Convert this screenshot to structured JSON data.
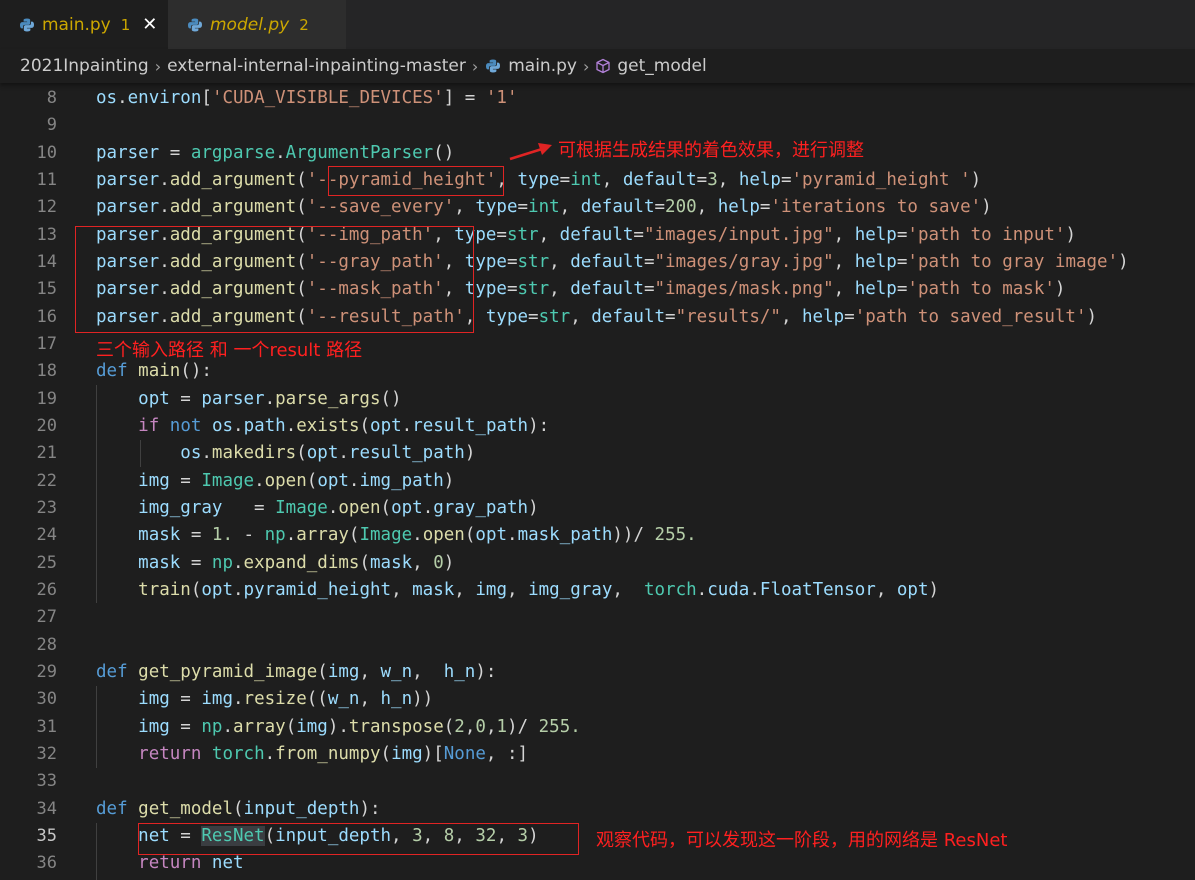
{
  "tabs": [
    {
      "label": "main.py",
      "count": "1",
      "close": "✕"
    },
    {
      "label": "model.py",
      "count": "2"
    }
  ],
  "breadcrumb": [
    "2021Inpainting",
    "external-internal-inpainting-master",
    "main.py",
    "get_model"
  ],
  "current_line": 35,
  "annotations": {
    "pyramid_note": "可根据生成结果的着色效果，进行调整",
    "paths_note": "三个输入路径 和 一个result 路径",
    "resnet_note": "观察代码，可以发现这一阶段，用的网络是 ResNet"
  },
  "colors": {
    "annotation": "#ff2020",
    "keyword": "#569cd6",
    "control": "#c586c0",
    "string": "#ce9178",
    "number": "#b5cea8",
    "variable": "#9cdcfe",
    "function": "#dcdcaa",
    "class": "#4ec9b0"
  },
  "code_lines": [
    {
      "num": 8,
      "tokens": [
        [
          "v",
          "os"
        ],
        [
          "p",
          "."
        ],
        [
          "v",
          "environ"
        ],
        [
          "p",
          "["
        ],
        [
          "s",
          "'CUDA_VISIBLE_DEVICES'"
        ],
        [
          "p",
          "] = "
        ],
        [
          "s",
          "'1'"
        ]
      ]
    },
    {
      "num": 9,
      "tokens": []
    },
    {
      "num": 10,
      "tokens": [
        [
          "v",
          "parser"
        ],
        [
          "p",
          " = "
        ],
        [
          "t",
          "argparse"
        ],
        [
          "p",
          "."
        ],
        [
          "t",
          "ArgumentParser"
        ],
        [
          "p",
          "()"
        ]
      ]
    },
    {
      "num": 11,
      "tokens": [
        [
          "v",
          "parser"
        ],
        [
          "p",
          "."
        ],
        [
          "f",
          "add_argument"
        ],
        [
          "p",
          "("
        ],
        [
          "s",
          "'--pyramid_height'"
        ],
        [
          "p",
          ", "
        ],
        [
          "v",
          "type"
        ],
        [
          "p",
          "="
        ],
        [
          "t",
          "int"
        ],
        [
          "p",
          ", "
        ],
        [
          "v",
          "default"
        ],
        [
          "p",
          "="
        ],
        [
          "n",
          "3"
        ],
        [
          "p",
          ", "
        ],
        [
          "v",
          "help"
        ],
        [
          "p",
          "="
        ],
        [
          "s",
          "'pyramid_height '"
        ],
        [
          "p",
          ")"
        ]
      ]
    },
    {
      "num": 12,
      "tokens": [
        [
          "v",
          "parser"
        ],
        [
          "p",
          "."
        ],
        [
          "f",
          "add_argument"
        ],
        [
          "p",
          "("
        ],
        [
          "s",
          "'--save_every'"
        ],
        [
          "p",
          ", "
        ],
        [
          "v",
          "type"
        ],
        [
          "p",
          "="
        ],
        [
          "t",
          "int"
        ],
        [
          "p",
          ", "
        ],
        [
          "v",
          "default"
        ],
        [
          "p",
          "="
        ],
        [
          "n",
          "200"
        ],
        [
          "p",
          ", "
        ],
        [
          "v",
          "help"
        ],
        [
          "p",
          "="
        ],
        [
          "s",
          "'iterations to save'"
        ],
        [
          "p",
          ")"
        ]
      ]
    },
    {
      "num": 13,
      "tokens": [
        [
          "v",
          "parser"
        ],
        [
          "p",
          "."
        ],
        [
          "f",
          "add_argument"
        ],
        [
          "p",
          "("
        ],
        [
          "s",
          "'--img_path'"
        ],
        [
          "p",
          ", "
        ],
        [
          "v",
          "type"
        ],
        [
          "p",
          "="
        ],
        [
          "t",
          "str"
        ],
        [
          "p",
          ", "
        ],
        [
          "v",
          "default"
        ],
        [
          "p",
          "="
        ],
        [
          "s",
          "\"images/input.jpg\""
        ],
        [
          "p",
          ", "
        ],
        [
          "v",
          "help"
        ],
        [
          "p",
          "="
        ],
        [
          "s",
          "'path to input'"
        ],
        [
          "p",
          ")"
        ]
      ]
    },
    {
      "num": 14,
      "tokens": [
        [
          "v",
          "parser"
        ],
        [
          "p",
          "."
        ],
        [
          "f",
          "add_argument"
        ],
        [
          "p",
          "("
        ],
        [
          "s",
          "'--gray_path'"
        ],
        [
          "p",
          ", "
        ],
        [
          "v",
          "type"
        ],
        [
          "p",
          "="
        ],
        [
          "t",
          "str"
        ],
        [
          "p",
          ", "
        ],
        [
          "v",
          "default"
        ],
        [
          "p",
          "="
        ],
        [
          "s",
          "\"images/gray.jpg\""
        ],
        [
          "p",
          ", "
        ],
        [
          "v",
          "help"
        ],
        [
          "p",
          "="
        ],
        [
          "s",
          "'path to gray image'"
        ],
        [
          "p",
          ")"
        ]
      ]
    },
    {
      "num": 15,
      "tokens": [
        [
          "v",
          "parser"
        ],
        [
          "p",
          "."
        ],
        [
          "f",
          "add_argument"
        ],
        [
          "p",
          "("
        ],
        [
          "s",
          "'--mask_path'"
        ],
        [
          "p",
          ", "
        ],
        [
          "v",
          "type"
        ],
        [
          "p",
          "="
        ],
        [
          "t",
          "str"
        ],
        [
          "p",
          ", "
        ],
        [
          "v",
          "default"
        ],
        [
          "p",
          "="
        ],
        [
          "s",
          "\"images/mask.png\""
        ],
        [
          "p",
          ", "
        ],
        [
          "v",
          "help"
        ],
        [
          "p",
          "="
        ],
        [
          "s",
          "'path to mask'"
        ],
        [
          "p",
          ")"
        ]
      ]
    },
    {
      "num": 16,
      "tokens": [
        [
          "v",
          "parser"
        ],
        [
          "p",
          "."
        ],
        [
          "f",
          "add_argument"
        ],
        [
          "p",
          "("
        ],
        [
          "s",
          "'--result_path'"
        ],
        [
          "p",
          ", "
        ],
        [
          "v",
          "type"
        ],
        [
          "p",
          "="
        ],
        [
          "t",
          "str"
        ],
        [
          "p",
          ", "
        ],
        [
          "v",
          "default"
        ],
        [
          "p",
          "="
        ],
        [
          "s",
          "\"results/\""
        ],
        [
          "p",
          ", "
        ],
        [
          "v",
          "help"
        ],
        [
          "p",
          "="
        ],
        [
          "s",
          "'path to saved_result'"
        ],
        [
          "p",
          ")"
        ]
      ]
    },
    {
      "num": 17,
      "tokens": []
    },
    {
      "num": 18,
      "tokens": [
        [
          "k",
          "def"
        ],
        [
          "p",
          " "
        ],
        [
          "f",
          "main"
        ],
        [
          "p",
          "():"
        ]
      ]
    },
    {
      "num": 19,
      "tokens": [
        [
          "p",
          "    "
        ],
        [
          "v",
          "opt"
        ],
        [
          "p",
          " = "
        ],
        [
          "v",
          "parser"
        ],
        [
          "p",
          "."
        ],
        [
          "f",
          "parse_args"
        ],
        [
          "p",
          "()"
        ]
      ]
    },
    {
      "num": 20,
      "tokens": [
        [
          "p",
          "    "
        ],
        [
          "c",
          "if"
        ],
        [
          "p",
          " "
        ],
        [
          "k",
          "not"
        ],
        [
          "p",
          " "
        ],
        [
          "v",
          "os"
        ],
        [
          "p",
          "."
        ],
        [
          "v",
          "path"
        ],
        [
          "p",
          "."
        ],
        [
          "f",
          "exists"
        ],
        [
          "p",
          "("
        ],
        [
          "v",
          "opt"
        ],
        [
          "p",
          "."
        ],
        [
          "v",
          "result_path"
        ],
        [
          "p",
          "):"
        ]
      ]
    },
    {
      "num": 21,
      "tokens": [
        [
          "p",
          "        "
        ],
        [
          "v",
          "os"
        ],
        [
          "p",
          "."
        ],
        [
          "f",
          "makedirs"
        ],
        [
          "p",
          "("
        ],
        [
          "v",
          "opt"
        ],
        [
          "p",
          "."
        ],
        [
          "v",
          "result_path"
        ],
        [
          "p",
          ")"
        ]
      ]
    },
    {
      "num": 22,
      "tokens": [
        [
          "p",
          "    "
        ],
        [
          "v",
          "img"
        ],
        [
          "p",
          " = "
        ],
        [
          "t",
          "Image"
        ],
        [
          "p",
          "."
        ],
        [
          "f",
          "open"
        ],
        [
          "p",
          "("
        ],
        [
          "v",
          "opt"
        ],
        [
          "p",
          "."
        ],
        [
          "v",
          "img_path"
        ],
        [
          "p",
          ")"
        ]
      ]
    },
    {
      "num": 23,
      "tokens": [
        [
          "p",
          "    "
        ],
        [
          "v",
          "img_gray"
        ],
        [
          "p",
          "   = "
        ],
        [
          "t",
          "Image"
        ],
        [
          "p",
          "."
        ],
        [
          "f",
          "open"
        ],
        [
          "p",
          "("
        ],
        [
          "v",
          "opt"
        ],
        [
          "p",
          "."
        ],
        [
          "v",
          "gray_path"
        ],
        [
          "p",
          ")"
        ]
      ]
    },
    {
      "num": 24,
      "tokens": [
        [
          "p",
          "    "
        ],
        [
          "v",
          "mask"
        ],
        [
          "p",
          " = "
        ],
        [
          "n",
          "1."
        ],
        [
          "p",
          " - "
        ],
        [
          "t",
          "np"
        ],
        [
          "p",
          "."
        ],
        [
          "f",
          "array"
        ],
        [
          "p",
          "("
        ],
        [
          "t",
          "Image"
        ],
        [
          "p",
          "."
        ],
        [
          "f",
          "open"
        ],
        [
          "p",
          "("
        ],
        [
          "v",
          "opt"
        ],
        [
          "p",
          "."
        ],
        [
          "v",
          "mask_path"
        ],
        [
          "p",
          "))/ "
        ],
        [
          "n",
          "255."
        ]
      ]
    },
    {
      "num": 25,
      "tokens": [
        [
          "p",
          "    "
        ],
        [
          "v",
          "mask"
        ],
        [
          "p",
          " = "
        ],
        [
          "t",
          "np"
        ],
        [
          "p",
          "."
        ],
        [
          "f",
          "expand_dims"
        ],
        [
          "p",
          "("
        ],
        [
          "v",
          "mask"
        ],
        [
          "p",
          ", "
        ],
        [
          "n",
          "0"
        ],
        [
          "p",
          ")"
        ]
      ]
    },
    {
      "num": 26,
      "tokens": [
        [
          "p",
          "    "
        ],
        [
          "f",
          "train"
        ],
        [
          "p",
          "("
        ],
        [
          "v",
          "opt"
        ],
        [
          "p",
          "."
        ],
        [
          "v",
          "pyramid_height"
        ],
        [
          "p",
          ", "
        ],
        [
          "v",
          "mask"
        ],
        [
          "p",
          ", "
        ],
        [
          "v",
          "img"
        ],
        [
          "p",
          ", "
        ],
        [
          "v",
          "img_gray"
        ],
        [
          "p",
          ",  "
        ],
        [
          "t",
          "torch"
        ],
        [
          "p",
          "."
        ],
        [
          "v",
          "cuda"
        ],
        [
          "p",
          "."
        ],
        [
          "v",
          "FloatTensor"
        ],
        [
          "p",
          ", "
        ],
        [
          "v",
          "opt"
        ],
        [
          "p",
          ")"
        ]
      ]
    },
    {
      "num": 27,
      "tokens": []
    },
    {
      "num": 28,
      "tokens": []
    },
    {
      "num": 29,
      "tokens": [
        [
          "k",
          "def"
        ],
        [
          "p",
          " "
        ],
        [
          "f",
          "get_pyramid_image"
        ],
        [
          "p",
          "("
        ],
        [
          "v",
          "img"
        ],
        [
          "p",
          ", "
        ],
        [
          "v",
          "w_n"
        ],
        [
          "p",
          ",  "
        ],
        [
          "v",
          "h_n"
        ],
        [
          "p",
          "):"
        ]
      ]
    },
    {
      "num": 30,
      "tokens": [
        [
          "p",
          "    "
        ],
        [
          "v",
          "img"
        ],
        [
          "p",
          " = "
        ],
        [
          "v",
          "img"
        ],
        [
          "p",
          "."
        ],
        [
          "f",
          "resize"
        ],
        [
          "p",
          "(("
        ],
        [
          "v",
          "w_n"
        ],
        [
          "p",
          ", "
        ],
        [
          "v",
          "h_n"
        ],
        [
          "p",
          "))"
        ]
      ]
    },
    {
      "num": 31,
      "tokens": [
        [
          "p",
          "    "
        ],
        [
          "v",
          "img"
        ],
        [
          "p",
          " = "
        ],
        [
          "t",
          "np"
        ],
        [
          "p",
          "."
        ],
        [
          "f",
          "array"
        ],
        [
          "p",
          "("
        ],
        [
          "v",
          "img"
        ],
        [
          "p",
          ")."
        ],
        [
          "f",
          "transpose"
        ],
        [
          "p",
          "("
        ],
        [
          "n",
          "2"
        ],
        [
          "p",
          ","
        ],
        [
          "n",
          "0"
        ],
        [
          "p",
          ","
        ],
        [
          "n",
          "1"
        ],
        [
          "p",
          ")/ "
        ],
        [
          "n",
          "255."
        ]
      ]
    },
    {
      "num": 32,
      "tokens": [
        [
          "p",
          "    "
        ],
        [
          "c",
          "return"
        ],
        [
          "p",
          " "
        ],
        [
          "t",
          "torch"
        ],
        [
          "p",
          "."
        ],
        [
          "f",
          "from_numpy"
        ],
        [
          "p",
          "("
        ],
        [
          "v",
          "img"
        ],
        [
          "p",
          ")["
        ],
        [
          "k",
          "None"
        ],
        [
          "p",
          ", :]"
        ]
      ]
    },
    {
      "num": 33,
      "tokens": []
    },
    {
      "num": 34,
      "tokens": [
        [
          "k",
          "def"
        ],
        [
          "p",
          " "
        ],
        [
          "f",
          "get_model"
        ],
        [
          "p",
          "("
        ],
        [
          "v",
          "input_depth"
        ],
        [
          "p",
          "):"
        ]
      ]
    },
    {
      "num": 35,
      "tokens": [
        [
          "p",
          "    "
        ],
        [
          "v",
          "net"
        ],
        [
          "p",
          " = "
        ],
        [
          "hlt",
          "ResNet"
        ],
        [
          "p",
          "("
        ],
        [
          "v",
          "input_depth"
        ],
        [
          "p",
          ", "
        ],
        [
          "n",
          "3"
        ],
        [
          "p",
          ", "
        ],
        [
          "n",
          "8"
        ],
        [
          "p",
          ", "
        ],
        [
          "n",
          "32"
        ],
        [
          "p",
          ", "
        ],
        [
          "n",
          "3"
        ],
        [
          "p",
          ")"
        ]
      ]
    },
    {
      "num": 36,
      "tokens": [
        [
          "p",
          "    "
        ],
        [
          "c",
          "return"
        ],
        [
          "p",
          " "
        ],
        [
          "v",
          "net"
        ]
      ]
    }
  ]
}
